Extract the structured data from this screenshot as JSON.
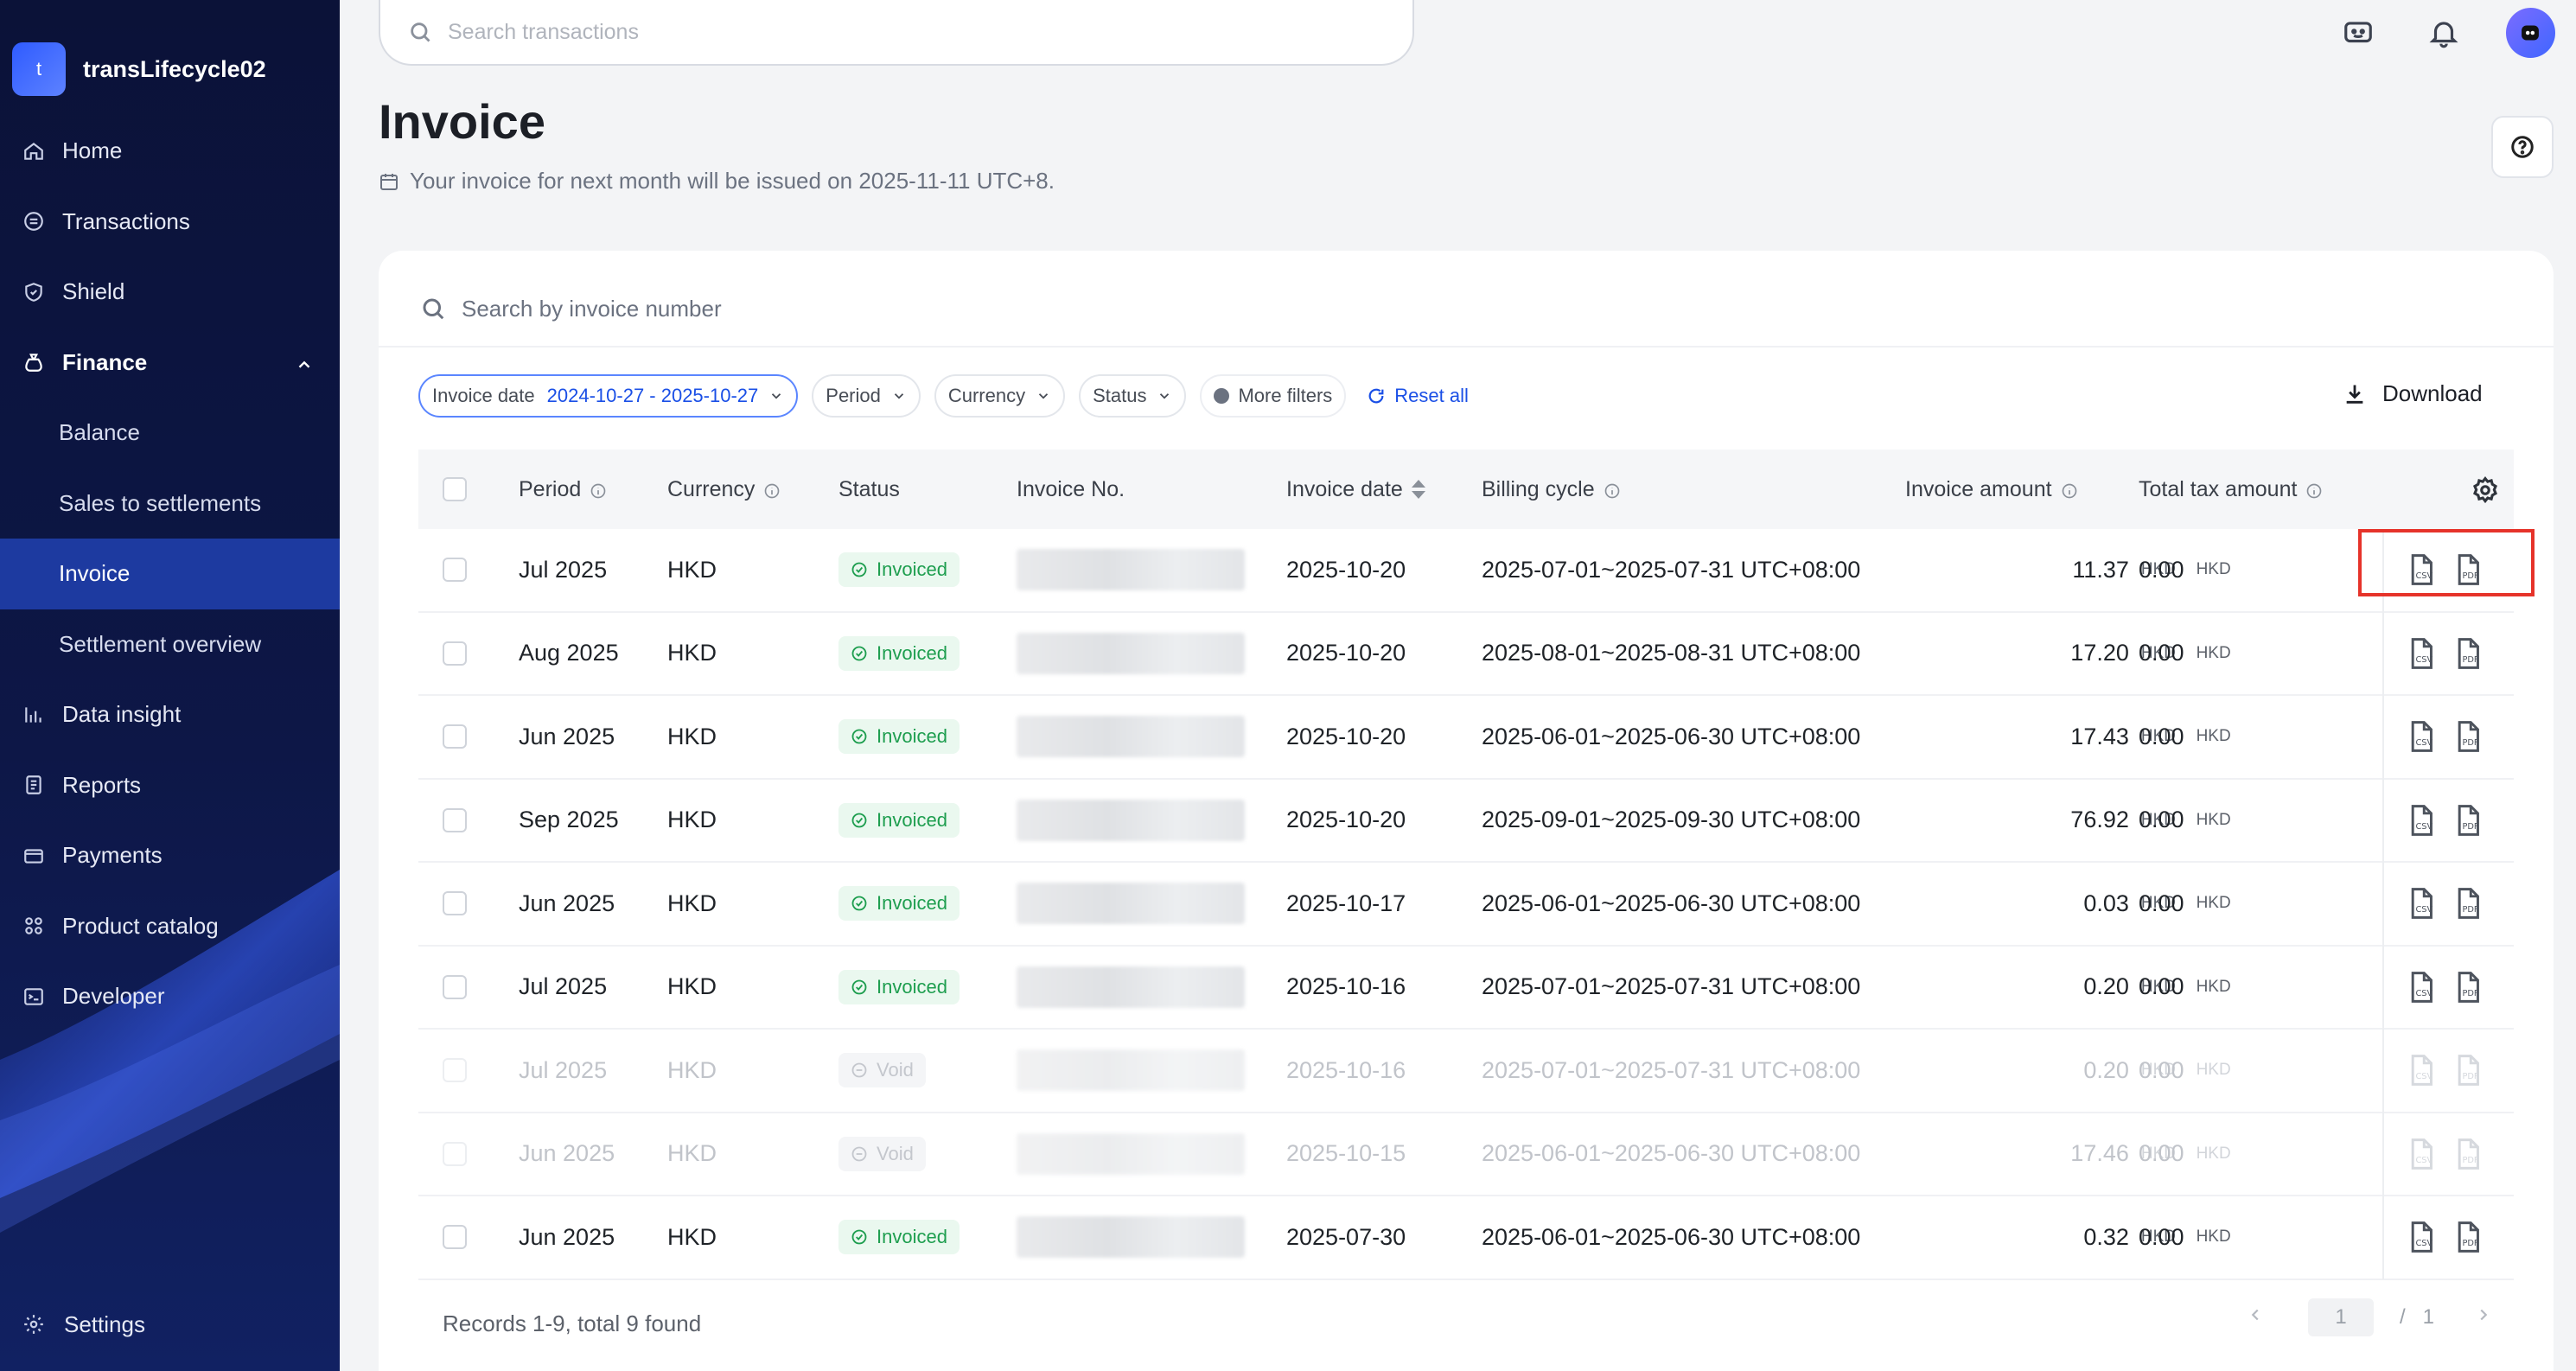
{
  "top": {
    "search_placeholder": "Search transactions"
  },
  "sidebar": {
    "account_initial": "t",
    "account_name": "transLifecycle02",
    "items": [
      {
        "label": "Home"
      },
      {
        "label": "Transactions"
      },
      {
        "label": "Shield"
      },
      {
        "label": "Finance"
      },
      {
        "label": "Balance"
      },
      {
        "label": "Sales to settlements"
      },
      {
        "label": "Invoice"
      },
      {
        "label": "Settlement overview"
      },
      {
        "label": "Data insight"
      },
      {
        "label": "Reports"
      },
      {
        "label": "Payments"
      },
      {
        "label": "Product catalog"
      },
      {
        "label": "Developer"
      }
    ],
    "settings_label": "Settings"
  },
  "page": {
    "title": "Invoice",
    "issue_note": "Your invoice for next month will be issued on 2025-11-11 UTC+8."
  },
  "card": {
    "search_placeholder": "Search by invoice number",
    "filters": {
      "invoice_date_label": "Invoice date",
      "invoice_date_value": "2024-10-27 - 2025-10-27",
      "period": "Period",
      "currency": "Currency",
      "status": "Status",
      "more_filters": "More filters",
      "reset_all": "Reset all"
    },
    "download_label": "Download"
  },
  "table": {
    "headers": {
      "period": "Period",
      "currency": "Currency",
      "status": "Status",
      "invoice_no": "Invoice No.",
      "invoice_date": "Invoice date",
      "billing_cycle": "Billing cycle",
      "invoice_amount": "Invoice amount",
      "total_tax": "Total tax amount"
    },
    "icons": {
      "csv": "CSV",
      "pdf": "PDF"
    },
    "rows": [
      {
        "period": "Jul 2025",
        "currency": "HKD",
        "status": "Invoiced",
        "date": "2025-10-20",
        "cycle": "2025-07-01~2025-07-31 UTC+08:00",
        "amount": "11.37",
        "amount_cur": "HKD",
        "tax": "0.00",
        "tax_cur": "HKD"
      },
      {
        "period": "Aug 2025",
        "currency": "HKD",
        "status": "Invoiced",
        "date": "2025-10-20",
        "cycle": "2025-08-01~2025-08-31 UTC+08:00",
        "amount": "17.20",
        "amount_cur": "HKD",
        "tax": "0.00",
        "tax_cur": "HKD"
      },
      {
        "period": "Jun 2025",
        "currency": "HKD",
        "status": "Invoiced",
        "date": "2025-10-20",
        "cycle": "2025-06-01~2025-06-30 UTC+08:00",
        "amount": "17.43",
        "amount_cur": "HKD",
        "tax": "0.00",
        "tax_cur": "HKD"
      },
      {
        "period": "Sep 2025",
        "currency": "HKD",
        "status": "Invoiced",
        "date": "2025-10-20",
        "cycle": "2025-09-01~2025-09-30 UTC+08:00",
        "amount": "76.92",
        "amount_cur": "HKD",
        "tax": "0.00",
        "tax_cur": "HKD"
      },
      {
        "period": "Jun 2025",
        "currency": "HKD",
        "status": "Invoiced",
        "date": "2025-10-17",
        "cycle": "2025-06-01~2025-06-30 UTC+08:00",
        "amount": "0.03",
        "amount_cur": "HKD",
        "tax": "0.00",
        "tax_cur": "HKD"
      },
      {
        "period": "Jul 2025",
        "currency": "HKD",
        "status": "Invoiced",
        "date": "2025-10-16",
        "cycle": "2025-07-01~2025-07-31 UTC+08:00",
        "amount": "0.20",
        "amount_cur": "HKD",
        "tax": "0.00",
        "tax_cur": "HKD"
      },
      {
        "period": "Jul 2025",
        "currency": "HKD",
        "status": "Void",
        "date": "2025-10-16",
        "cycle": "2025-07-01~2025-07-31 UTC+08:00",
        "amount": "0.20",
        "amount_cur": "HKD",
        "tax": "0.00",
        "tax_cur": "HKD"
      },
      {
        "period": "Jun 2025",
        "currency": "HKD",
        "status": "Void",
        "date": "2025-10-15",
        "cycle": "2025-06-01~2025-06-30 UTC+08:00",
        "amount": "17.46",
        "amount_cur": "HKD",
        "tax": "0.00",
        "tax_cur": "HKD"
      },
      {
        "period": "Jun 2025",
        "currency": "HKD",
        "status": "Invoiced",
        "date": "2025-07-30",
        "cycle": "2025-06-01~2025-06-30 UTC+08:00",
        "amount": "0.32",
        "amount_cur": "HKD",
        "tax": "0.00",
        "tax_cur": "HKD"
      }
    ]
  },
  "footer": {
    "records": "Records 1-9, total 9 found",
    "page_current": "1",
    "page_sep": "/",
    "page_total": "1"
  },
  "colors": {
    "sidebar_bg": "#0b1238",
    "active_nav": "#1d3aa0",
    "accent_blue": "#1a4fe6",
    "status_green": "#1e9e4f",
    "highlight_red": "#e6332a"
  }
}
